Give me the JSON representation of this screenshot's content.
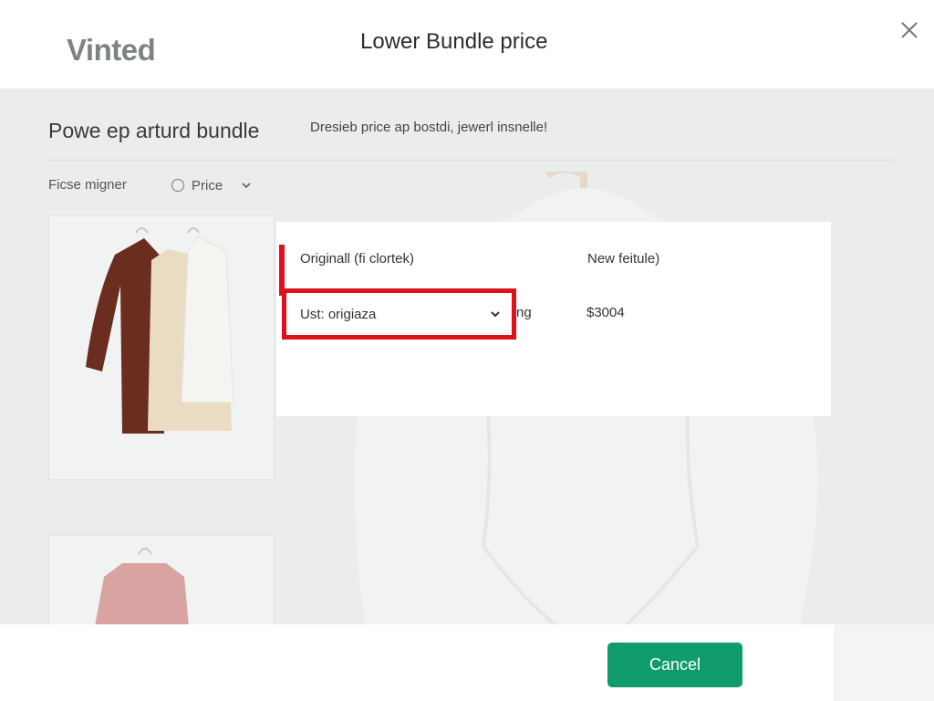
{
  "header": {
    "logo": "Vinted",
    "title": "Lower Bundle price",
    "close_icon": "close-icon"
  },
  "section": {
    "heading": "Powe ep arturd bundle",
    "subtitle": "Dresieb price ap bostdi, jewerl insnelle!"
  },
  "filters": {
    "label": "Ficse migner",
    "price_label": "Price",
    "price_icon": "radio-icon",
    "dropdown_icon": "chevron-down-icon"
  },
  "items": [
    {
      "name": "bundle-item-dresses",
      "colors": [
        "#6b2d1f",
        "#eadcc2",
        "#f4f4f1"
      ]
    },
    {
      "name": "bundle-item-pink-top",
      "colors": [
        "#d9a3a1"
      ]
    }
  ],
  "price_panel": {
    "original_header": "Originall (fi clortek)",
    "new_header": "New feitule)",
    "select_value": "Ust: origiaza",
    "partial_text": "ng",
    "new_price": "$3004"
  },
  "footer": {
    "cancel_label": "Cancel"
  },
  "colors": {
    "accent_green": "#0f9b6d",
    "highlight_red": "#e0111b"
  }
}
